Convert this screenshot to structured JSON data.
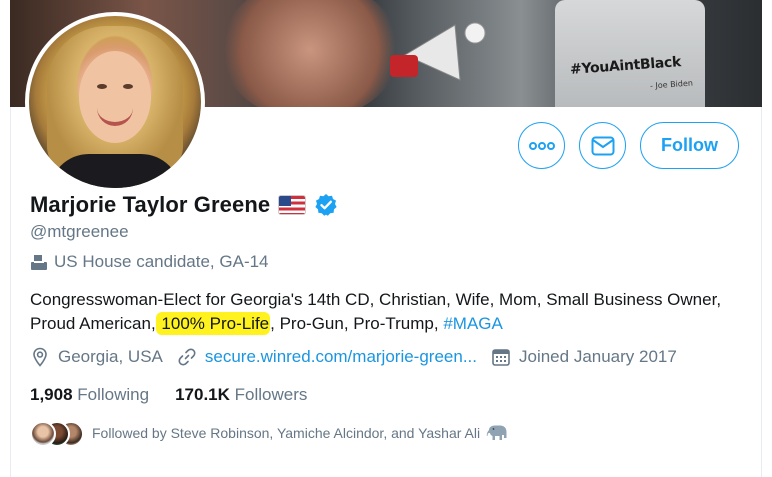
{
  "banner": {
    "shirt_text": "#YouAintBlack",
    "shirt_subtext": "- Joe Biden"
  },
  "profile": {
    "name": "Marjorie Taylor Greene",
    "handle": "@mtgreenee",
    "candidate_label": "US House candidate, GA-14",
    "bio": {
      "part1": "Congresswoman-Elect for Georgia's 14th CD, Christian, Wife, Mom, Small Business Owner, Proud American,",
      "highlight": " 100% Pro-Life",
      "part2": ", Pro-Gun, Pro-Trump, ",
      "hashtag": "#MAGA"
    },
    "location": "Georgia, USA",
    "website": "secure.winred.com/marjorie-green...",
    "joined": "Joined January 2017"
  },
  "counts": {
    "following_value": "1,908",
    "following_label": "Following",
    "followers_value": "170.1K",
    "followers_label": "Followers"
  },
  "followed_by": "Followed by Steve Robinson, Yamiche Alcindor, and Yashar Ali",
  "buttons": {
    "follow_label": "Follow"
  },
  "colors": {
    "accent": "#1da1f2",
    "highlight": "#fff21e",
    "secondary_text": "#657786"
  },
  "icons": {
    "more": "more-icon",
    "message": "envelope-icon",
    "verified": "verified-badge-icon",
    "flag": "us-flag-icon",
    "candidate": "ballot-box-icon",
    "location": "location-pin-icon",
    "website": "link-icon",
    "joined": "calendar-icon",
    "elephant": "elephant-icon"
  }
}
